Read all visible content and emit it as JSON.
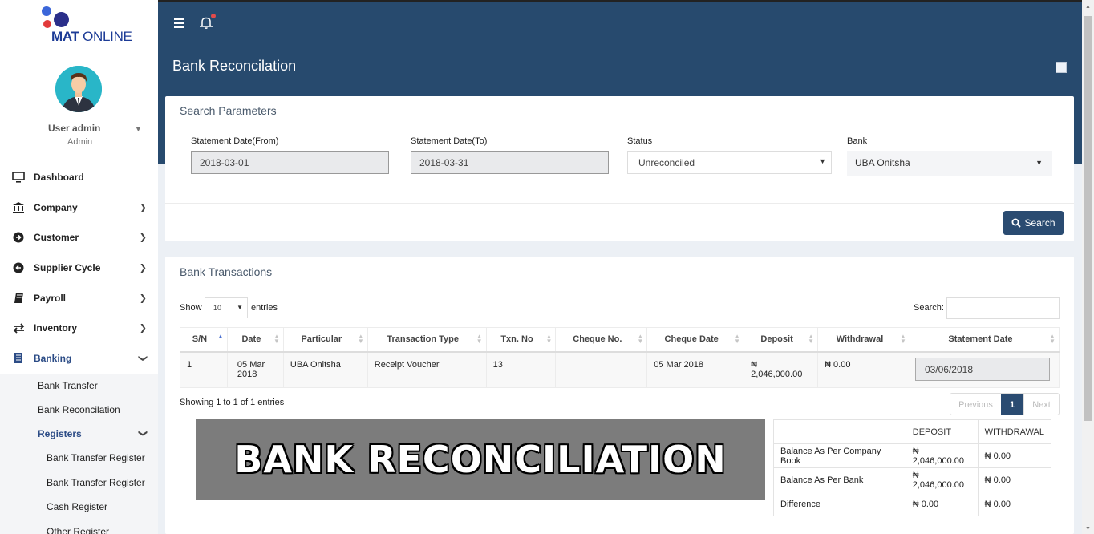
{
  "brand": {
    "name_bold": "MAT",
    "name_rest": " ONLINE"
  },
  "user": {
    "name": "User admin",
    "role": "Admin"
  },
  "sidebar": {
    "items": [
      {
        "label": "Dashboard",
        "icon": "monitor-icon"
      },
      {
        "label": "Company",
        "icon": "bank-building-icon"
      },
      {
        "label": "Customer",
        "icon": "arrow-circle-icon"
      },
      {
        "label": "Supplier Cycle",
        "icon": "arrow-circle-left-icon"
      },
      {
        "label": "Payroll",
        "icon": "book-icon"
      },
      {
        "label": "Inventory",
        "icon": "transfer-arrows-icon"
      },
      {
        "label": "Banking",
        "icon": "ledger-icon"
      }
    ],
    "banking_sub": [
      "Bank Transfer",
      "Bank Reconcilation"
    ],
    "registers_label": "Registers",
    "registers_sub": [
      "Bank Transfer Register",
      "Bank Transfer Register",
      "Cash Register",
      "Other Register"
    ]
  },
  "header": {
    "title": "Bank Reconcilation"
  },
  "search_panel": {
    "title": "Search Parameters",
    "from_label": "Statement Date(From)",
    "from_value": "2018-03-01",
    "to_label": "Statement Date(To)",
    "to_value": "2018-03-31",
    "status_label": "Status",
    "status_value": "Unreconciled",
    "bank_label": "Bank",
    "bank_value": "UBA Onitsha",
    "search_button": "Search"
  },
  "transactions": {
    "title": "Bank Transactions",
    "show_label": "Show",
    "show_value": "10",
    "entries_label": "entries",
    "search_label": "Search:",
    "columns": [
      "S/N",
      "Date",
      "Particular",
      "Transaction Type",
      "Txn. No",
      "Cheque No.",
      "Cheque Date",
      "Deposit",
      "Withdrawal",
      "Statement Date"
    ],
    "rows": [
      {
        "sn": "1",
        "date": "05 Mar 2018",
        "particular": "UBA Onitsha",
        "type": "Receipt Voucher",
        "txn": "13",
        "cheque_no": "",
        "cheque_date": "05 Mar 2018",
        "deposit": "₦ 2,046,000.00",
        "withdrawal": "₦ 0.00",
        "statement_date": "03/06/2018"
      }
    ],
    "showing": "Showing 1 to 1 of 1 entries",
    "pager": {
      "prev": "Previous",
      "current": "1",
      "next": "Next"
    }
  },
  "banner": {
    "text": "BANK RECONCILIATION"
  },
  "summary": {
    "headers": [
      "",
      "DEPOSIT",
      "WITHDRAWAL"
    ],
    "rows": [
      {
        "label": "Balance As Per Company Book",
        "deposit": "₦ 2,046,000.00",
        "withdrawal": "₦ 0.00"
      },
      {
        "label": "Balance As Per Bank",
        "deposit": "₦ 2,046,000.00",
        "withdrawal": "₦ 0.00"
      },
      {
        "label": "Difference",
        "deposit": "₦ 0.00",
        "withdrawal": "₦ 0.00"
      }
    ]
  },
  "colors": {
    "header_bg": "#274a6e",
    "button_bg": "#2a4b71",
    "brand_blue": "#1c3b96"
  }
}
